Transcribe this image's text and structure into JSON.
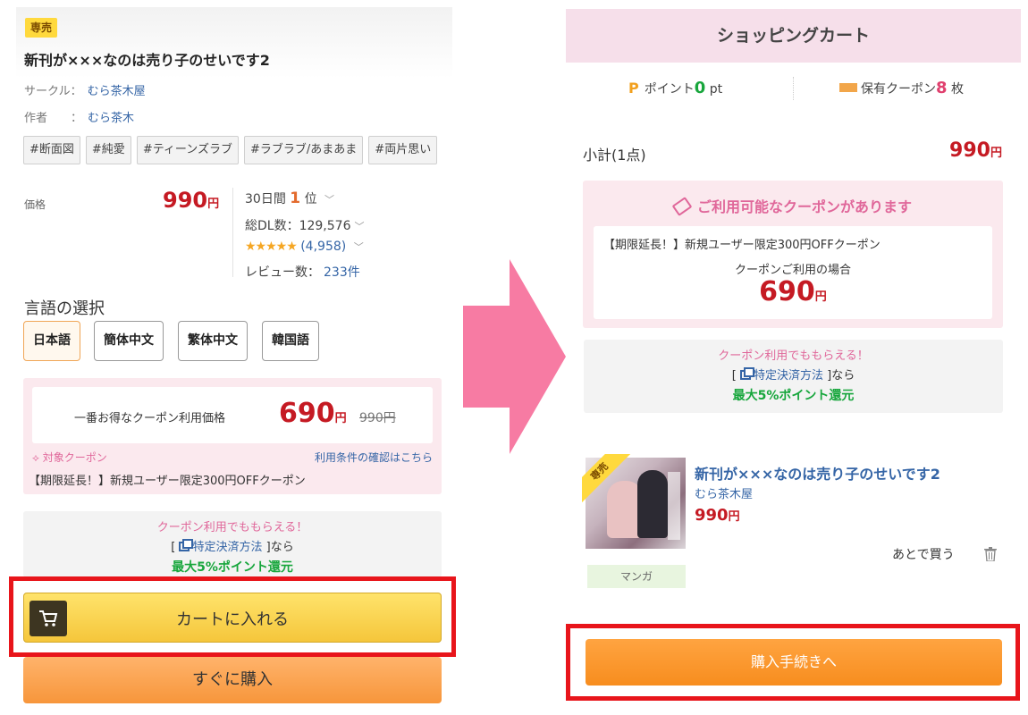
{
  "left": {
    "badge": "専売",
    "title": "新刊が×××なのは売り子のせいです2",
    "circle_label": "サークル：",
    "circle_name": "むら茶木屋",
    "author_label": "作者",
    "author_sep": "：",
    "author_name": "むら茶木",
    "tags": [
      "#断面図",
      "#純愛",
      "#ティーンズラブ",
      "#ラブラブ/あまあま",
      "#両片思い"
    ],
    "price_label": "価格",
    "price": "990",
    "yen": "円",
    "rank_prefix": "30日間",
    "rank_num": "1",
    "rank_suffix": "位",
    "downloads": "総DL数：129,576",
    "stars": "★★★★★",
    "rating_count": "(4,958)",
    "reviews_label": "レビュー数：",
    "reviews_count": "233件",
    "language_title": "言語の選択",
    "languages": [
      "日本語",
      "簡体中文",
      "繁体中文",
      "韓国語"
    ],
    "best_price_label": "一番お得なクーポン利用価格",
    "best_price": "690",
    "original_price": "990円",
    "target_coupon": "対象クーポン",
    "terms_link": "利用条件の確認はこちら",
    "coupon_desc": "【期限延長！】新規ユーザー限定300円OFFクーポン",
    "bonus_title": "クーポン利用でももらえる！",
    "bonus_bracket_open": "[",
    "bonus_link": "特定決済方法",
    "bonus_bracket_close": "]なら",
    "bonus_points": "最大5%ポイント還元",
    "cart_button": "カートに入れる",
    "buy_now_button": "すぐに購入"
  },
  "right": {
    "header": "ショッピングカート",
    "points_label": "ポイント",
    "points_value": "0",
    "points_unit": "pt",
    "coupons_label": "保有クーポン",
    "coupons_value": "8",
    "coupons_unit": "枚",
    "subtotal_label": "小計(1点)",
    "subtotal_price": "990",
    "yen": "円",
    "available_title": "ご利用可能なクーポンがあります",
    "coupon_desc": "【期限延長！】新規ユーザー限定300円OFFクーポン",
    "coupon_when": "クーポンご利用の場合",
    "coupon_price": "690",
    "bonus_title": "クーポン利用でももらえる！",
    "bonus_bracket_open": "[",
    "bonus_link": "特定決済方法",
    "bonus_bracket_close": "]なら",
    "bonus_points": "最大5%ポイント還元",
    "product_badge": "専売",
    "product_title": "新刊が×××なのは売り子のせいです2",
    "product_circle": "むら茶木屋",
    "product_price": "990",
    "genre": "マンガ",
    "later": "あとで買う",
    "checkout_button": "購入手続きへ"
  },
  "colors": {
    "price_red": "#c51a23",
    "highlight_frame": "#e8151b",
    "arrow_pink": "#f77ba3",
    "link_blue": "#3565a6",
    "points_green": "#17a63c",
    "coupon_pink": "#e0679a",
    "checkout_orange": "#f78d1e",
    "cart_yellow": "#f5c63b"
  },
  "icons": [
    "cart-icon",
    "coupon-ticket-icon",
    "external-link-icon",
    "trash-icon",
    "point-p-icon",
    "chevron-down-icon",
    "arrow-right-icon"
  ]
}
